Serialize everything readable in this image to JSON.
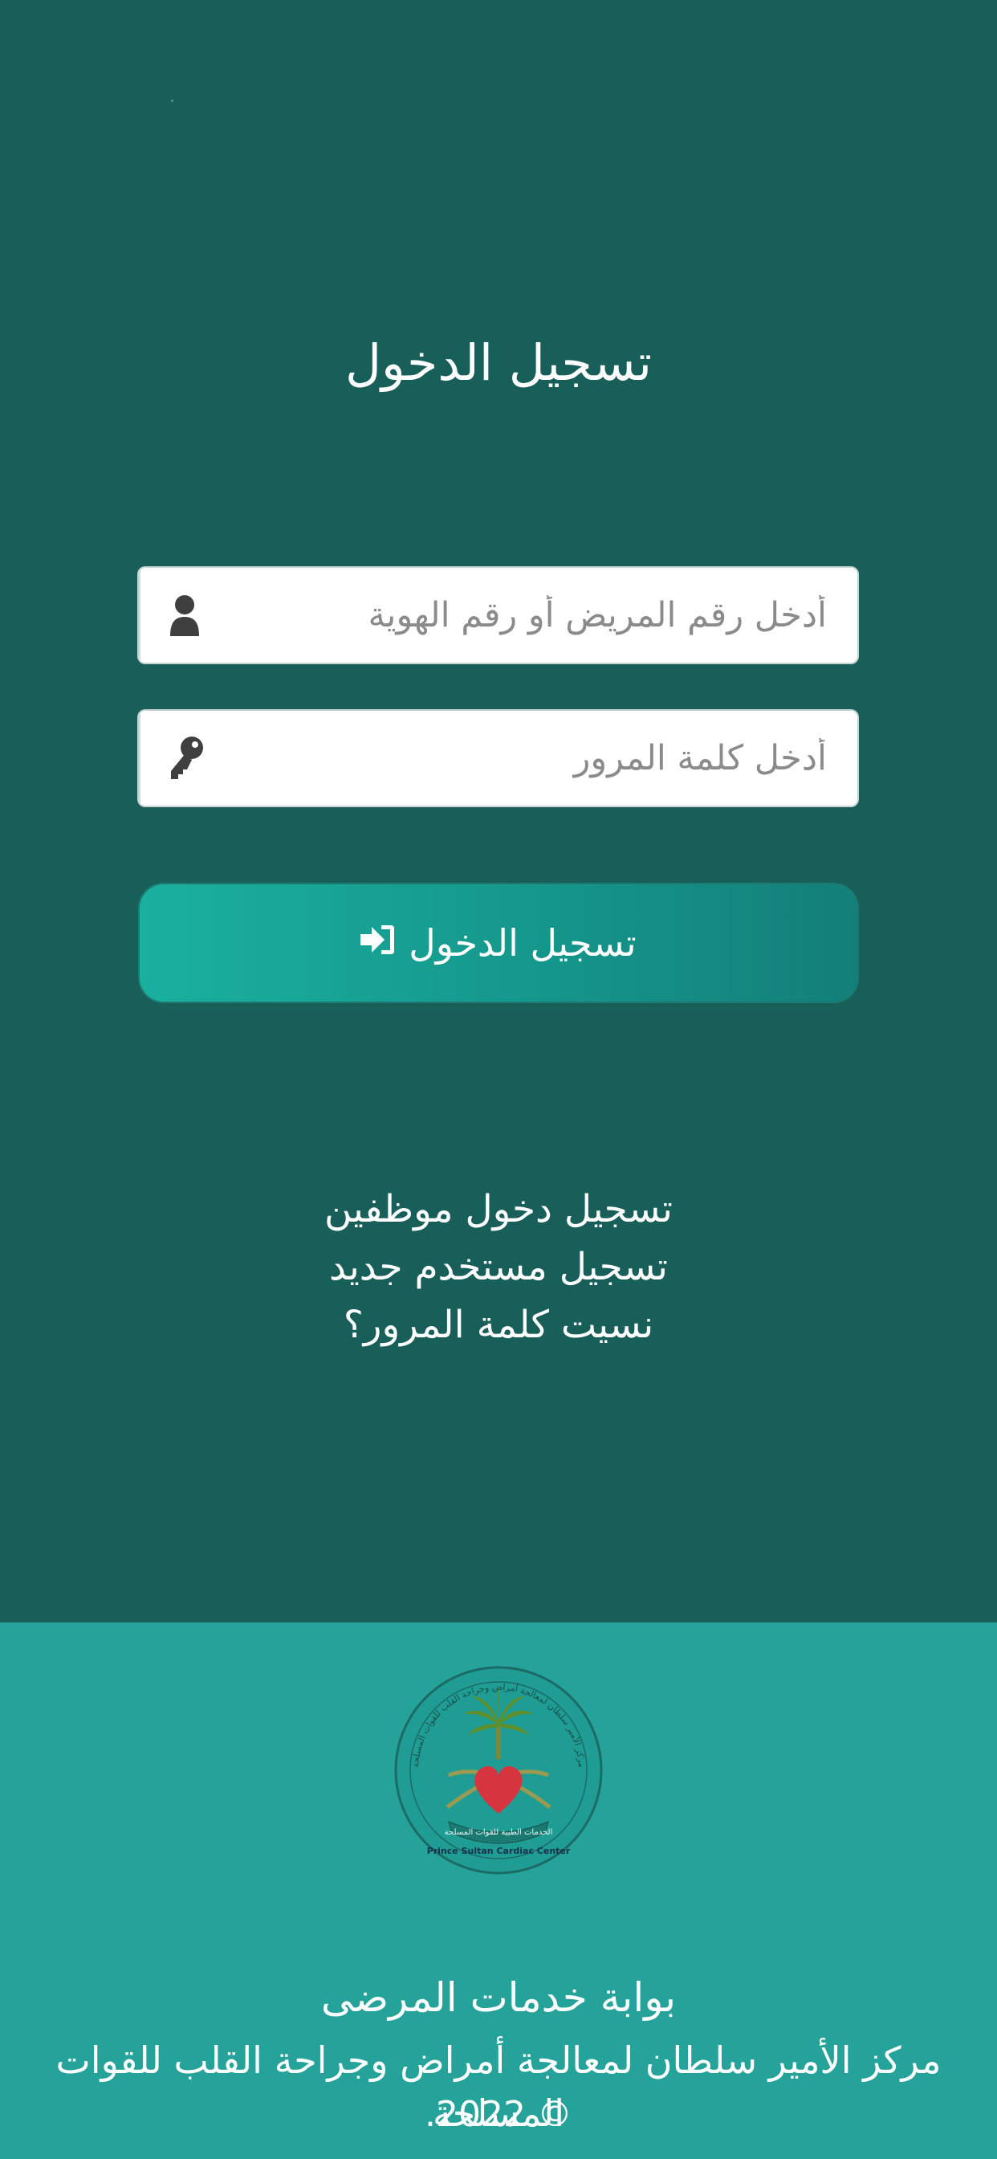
{
  "login": {
    "title": "تسجيل الدخول",
    "username_placeholder": "أدخل رقم المريض أو رقم الهوية",
    "password_placeholder": "أدخل كلمة المرور",
    "submit_label": "تسجيل الدخول",
    "username_icon": "user-icon",
    "password_icon": "key-icon",
    "submit_icon": "sign-in-icon"
  },
  "links": {
    "staff_login": "تسجيل دخول موظفين",
    "register": "تسجيل مستخدم جديد",
    "forgot_password": "نسيت كلمة المرور؟"
  },
  "footer": {
    "portal_title": "بوابة خدمات المرضى",
    "organization": "مركز الأمير سلطان لمعالجة أمراض وجراحة القلب للقوات المسلحة",
    "copyright": "© 2022.",
    "logo_ring_text": "مركز الأمير سلطان لمعالجة أمراض وجراحة القلب للقوات المسلحة",
    "logo_banner_text": "الخدمات الطبية للقوات المسلحة",
    "logo_english_text": "Prince Sultan Cardiac Center"
  },
  "colors": {
    "background": "#185f5a",
    "footer": "#25a39b",
    "button": "#1ab09e"
  }
}
